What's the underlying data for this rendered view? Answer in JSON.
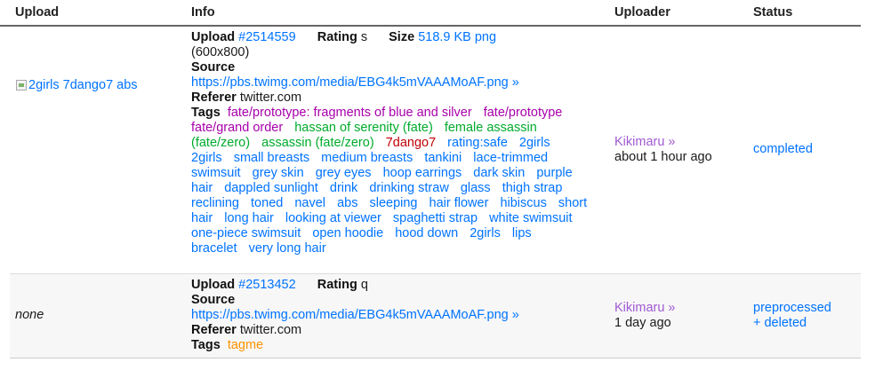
{
  "headers": {
    "upload": "Upload",
    "info": "Info",
    "uploader": "Uploader",
    "status": "Status"
  },
  "labels": {
    "upload": "Upload",
    "rating": "Rating",
    "size": "Size",
    "source": "Source",
    "referer": "Referer",
    "tags": "Tags"
  },
  "rows": [
    {
      "thumb_alt": "2girls 7dango7 abs",
      "upload_id": "#2514559",
      "rating": "s",
      "size": "518.9 KB png",
      "dimensions": "(600x800)",
      "source_url": "https://pbs.twimg.com/media/EBG4k5mVAAAMoAF.png »",
      "referer": "twitter.com",
      "uploader": "Kikimaru »",
      "time": "about 1 hour ago",
      "status": "completed",
      "tags": [
        {
          "t": "fate/prototype: fragments of blue and silver",
          "c": "copy"
        },
        {
          "t": "fate/prototype",
          "c": "copy"
        },
        {
          "t": "fate/grand order",
          "c": "copy"
        },
        {
          "t": "hassan of serenity (fate)",
          "c": "char"
        },
        {
          "t": "female assassin (fate/zero)",
          "c": "char"
        },
        {
          "t": "assassin (fate/zero)",
          "c": "char"
        },
        {
          "t": "7dango7",
          "c": "art"
        },
        {
          "t": "rating:safe",
          "c": "gen"
        },
        {
          "t": "2girls",
          "c": "gen"
        },
        {
          "t": "2girls",
          "c": "gen"
        },
        {
          "t": "small breasts",
          "c": "gen"
        },
        {
          "t": "medium breasts",
          "c": "gen"
        },
        {
          "t": "tankini",
          "c": "gen"
        },
        {
          "t": "lace-trimmed swimsuit",
          "c": "gen"
        },
        {
          "t": "grey skin",
          "c": "gen"
        },
        {
          "t": "grey eyes",
          "c": "gen"
        },
        {
          "t": "hoop earrings",
          "c": "gen"
        },
        {
          "t": "dark skin",
          "c": "gen"
        },
        {
          "t": "purple hair",
          "c": "gen"
        },
        {
          "t": "dappled sunlight",
          "c": "gen"
        },
        {
          "t": "drink",
          "c": "gen"
        },
        {
          "t": "drinking straw",
          "c": "gen"
        },
        {
          "t": "glass",
          "c": "gen"
        },
        {
          "t": "thigh strap",
          "c": "gen"
        },
        {
          "t": "reclining",
          "c": "gen"
        },
        {
          "t": "toned",
          "c": "gen"
        },
        {
          "t": "navel",
          "c": "gen"
        },
        {
          "t": "abs",
          "c": "gen"
        },
        {
          "t": "sleeping",
          "c": "gen"
        },
        {
          "t": "hair flower",
          "c": "gen"
        },
        {
          "t": "hibiscus",
          "c": "gen"
        },
        {
          "t": "short hair",
          "c": "gen"
        },
        {
          "t": "long hair",
          "c": "gen"
        },
        {
          "t": "looking at viewer",
          "c": "gen"
        },
        {
          "t": "spaghetti strap",
          "c": "gen"
        },
        {
          "t": "white swimsuit",
          "c": "gen"
        },
        {
          "t": "one-piece swimsuit",
          "c": "gen"
        },
        {
          "t": "open hoodie",
          "c": "gen"
        },
        {
          "t": "hood down",
          "c": "gen"
        },
        {
          "t": "2girls",
          "c": "gen"
        },
        {
          "t": "lips",
          "c": "gen"
        },
        {
          "t": "bracelet",
          "c": "gen"
        },
        {
          "t": "very long hair",
          "c": "gen"
        }
      ]
    },
    {
      "thumb": "none",
      "upload_id": "#2513452",
      "rating": "q",
      "source_url": "https://pbs.twimg.com/media/EBG4k5mVAAAMoAF.png »",
      "referer": "twitter.com",
      "uploader": "Kikimaru »",
      "time": "1 day ago",
      "status_line1": "preprocessed",
      "status_line2": "+ deleted",
      "tags": [
        {
          "t": "tagme",
          "c": "meta"
        }
      ]
    }
  ],
  "colors": {
    "link": "#0073ff",
    "copyright": "#a800aa",
    "character": "#00ab2c",
    "artist": "#c00004",
    "meta": "#fd9200",
    "user": "#a05ad2"
  }
}
